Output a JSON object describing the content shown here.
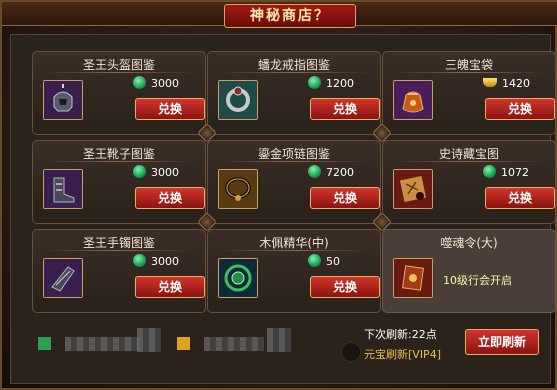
{
  "window": {
    "title": "神秘商店？"
  },
  "shop": {
    "items": [
      {
        "name": "圣王头盔图鉴",
        "price": "3000",
        "currency": "green-coin",
        "button": "兑换",
        "icon": "helmet-icon"
      },
      {
        "name": "蟠龙戒指图鉴",
        "price": "1200",
        "currency": "green-coin",
        "button": "兑换",
        "icon": "ring-icon"
      },
      {
        "name": "三魄宝袋",
        "price": "1420",
        "currency": "gold-ingot",
        "button": "兑换",
        "icon": "bag-icon"
      },
      {
        "name": "圣王靴子图鉴",
        "price": "3000",
        "currency": "green-coin",
        "button": "兑换",
        "icon": "boots-icon"
      },
      {
        "name": "鎏金项链图鉴",
        "price": "7200",
        "currency": "green-coin",
        "button": "兑换",
        "icon": "necklace-icon"
      },
      {
        "name": "史诗藏宝图",
        "price": "1072",
        "currency": "green-coin",
        "button": "兑换",
        "icon": "treasure-map-icon"
      },
      {
        "name": "圣王手镯图鉴",
        "price": "3000",
        "currency": "green-coin",
        "button": "兑换",
        "icon": "bracelet-icon"
      },
      {
        "name": "木佩精华(中)",
        "price": "50",
        "currency": "green-coin",
        "button": "兑换",
        "icon": "essence-icon"
      }
    ],
    "locked": {
      "name": "噬魂令(大)",
      "text": "10级行会开启",
      "icon": "token-icon"
    }
  },
  "footer": {
    "next_refresh": "下次刷新:22点",
    "vip_refresh": "元宝刷新[VIP4]",
    "refresh_button": "立即刷新"
  },
  "colors": {
    "accent_red": "#b0221a",
    "gold_border": "#c8a060",
    "green_currency": "#18a050"
  }
}
